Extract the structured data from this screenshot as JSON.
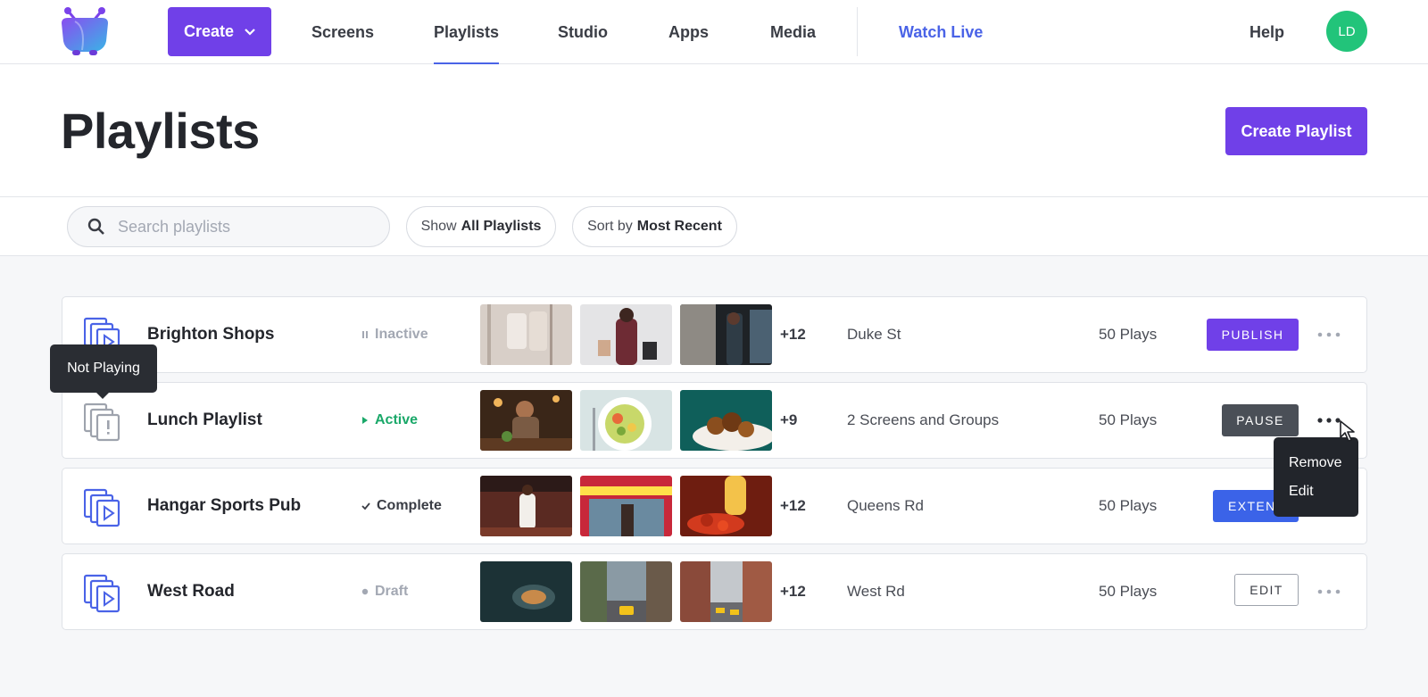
{
  "nav": {
    "create_label": "Create",
    "items": [
      "Screens",
      "Playlists",
      "Studio",
      "Apps",
      "Media"
    ],
    "active": "Playlists",
    "watch_live": "Watch Live",
    "help": "Help",
    "avatar_initials": "LD"
  },
  "header": {
    "title": "Playlists",
    "create_button": "Create Playlist"
  },
  "filters": {
    "search_placeholder": "Search playlists",
    "show_prefix": "Show",
    "show_value": "All Playlists",
    "sort_prefix": "Sort by",
    "sort_value": "Most Recent"
  },
  "playlists": [
    {
      "name": "Brighton Shops",
      "status": "Inactive",
      "status_color": "#a3a8b3",
      "status_icon": "pause-icon",
      "more": "+12",
      "location": "Duke St",
      "plays": "50 Plays",
      "action": "PUBLISH"
    },
    {
      "name": "Lunch Playlist",
      "status": "Active",
      "status_color": "#1aa869",
      "status_icon": "play-icon",
      "more": "+9",
      "location": "2 Screens and Groups",
      "plays": "50 Plays",
      "action": "PAUSE"
    },
    {
      "name": "Hangar Sports Pub",
      "status": "Complete",
      "status_color": "#3a3d45",
      "status_icon": "check-icon",
      "more": "+12",
      "location": "Queens Rd",
      "plays": "50 Plays",
      "action": "EXTEN"
    },
    {
      "name": "West Road",
      "status": "Draft",
      "status_color": "#a3a8b3",
      "status_icon": "dot-icon",
      "more": "+12",
      "location": "West Rd",
      "plays": "50 Plays",
      "action": "EDIT"
    }
  ],
  "tooltip": "Not Playing",
  "context_menu": [
    "Remove",
    "Edit"
  ],
  "colors": {
    "brand": "#7040e8",
    "link": "#4a63e7",
    "active": "#1aa869",
    "avatar": "#22c47a"
  }
}
